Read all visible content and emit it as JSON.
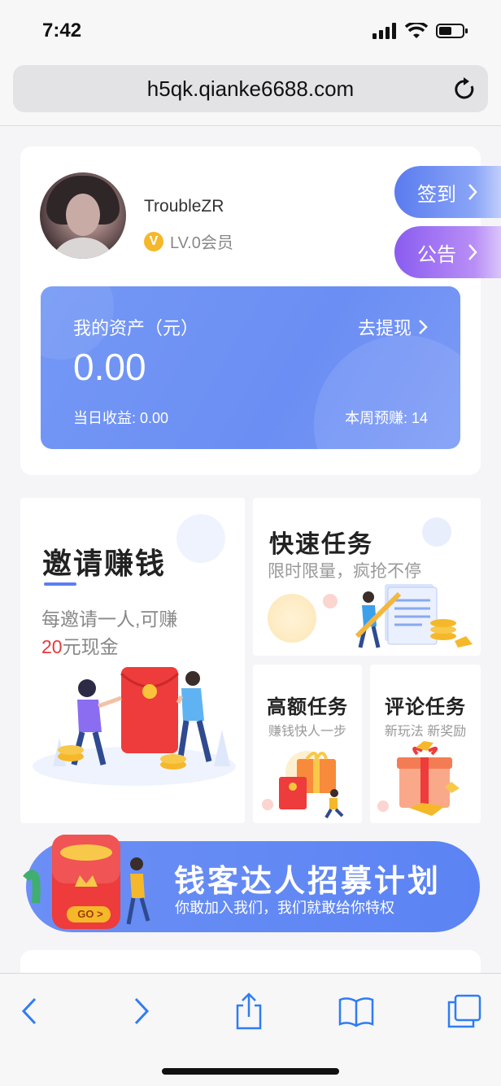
{
  "status_bar": {
    "time": "7:42"
  },
  "browser": {
    "url": "h5qk.qianke6688.com"
  },
  "profile": {
    "username": "TroubleZR",
    "badge_letter": "V",
    "level": "LV.0会员",
    "sign_in_label": "签到",
    "notice_label": "公告"
  },
  "assets": {
    "label": "我的资产（元）",
    "value": "0.00",
    "withdraw_label": "去提现",
    "today_earnings": "当日收益: 0.00",
    "week_estimate": "本周预赚: 14"
  },
  "tasks": {
    "invite": {
      "title": "邀请赚钱",
      "sub1": "每邀请一人,可赚",
      "amount": "20",
      "sub2_rest": "元现金"
    },
    "fast": {
      "title": "快速任务",
      "subtitle": "限时限量，疯抢不停"
    },
    "high": {
      "title": "高额任务",
      "subtitle": "赚钱快人一步"
    },
    "comment": {
      "title": "评论任务",
      "subtitle": "新玩法 新奖励"
    }
  },
  "banner": {
    "title": "钱客达人招募计划",
    "subtitle": "你敢加入我们，我们就敢给你特权",
    "go_label": "GO >"
  },
  "colors": {
    "accent": "#6b8ef4",
    "purple": "#8a5cf0",
    "red": "#e8383d",
    "gold": "#f5b82a"
  },
  "toolbar": {
    "icons": [
      "back-icon",
      "forward-icon",
      "share-icon",
      "bookmarks-icon",
      "tabs-icon"
    ]
  }
}
